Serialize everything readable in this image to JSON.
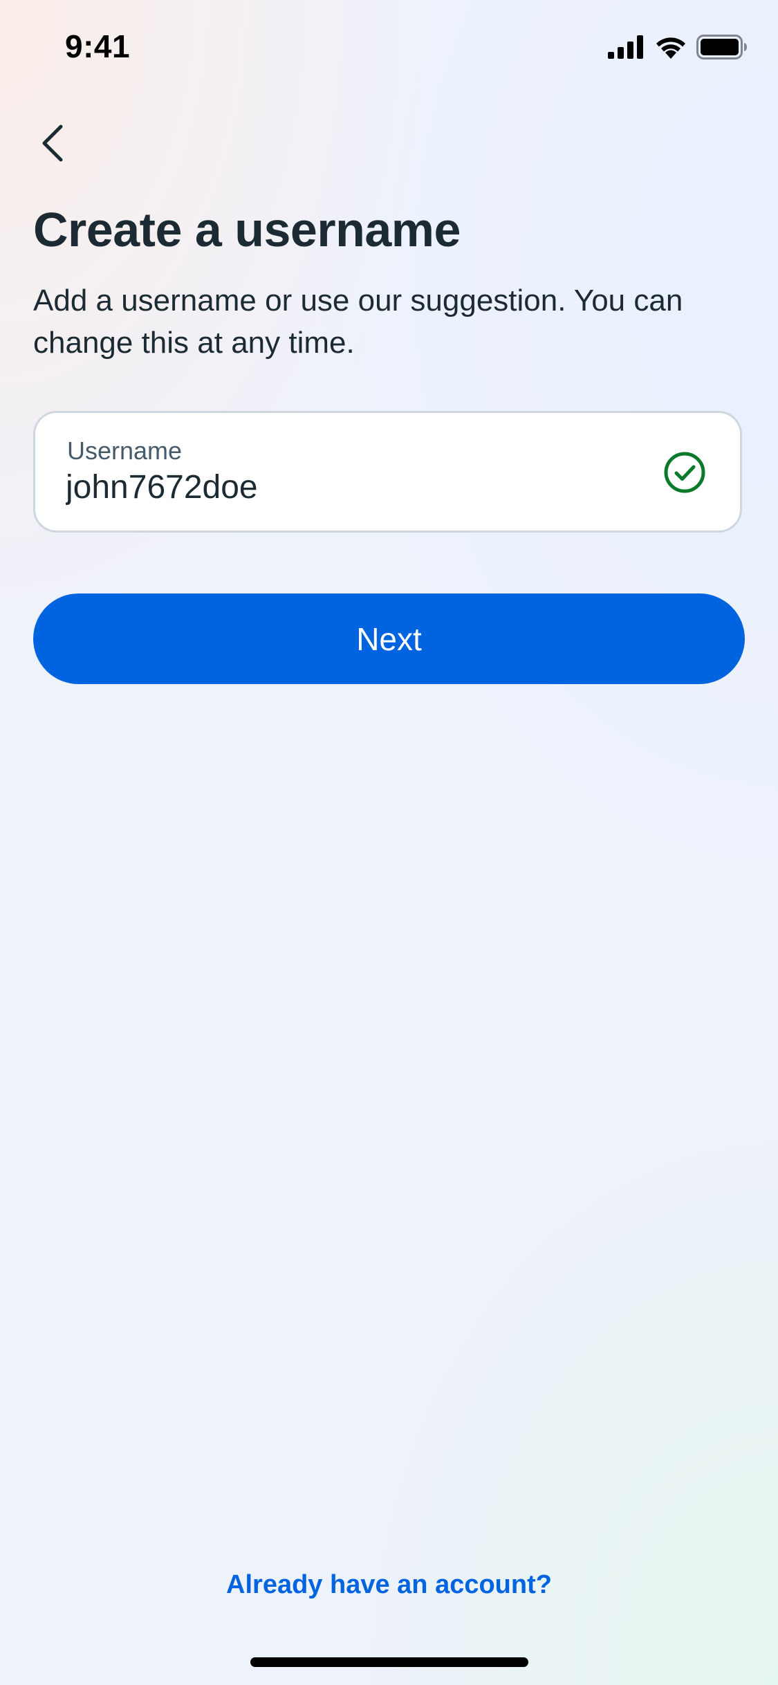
{
  "status_bar": {
    "time": "9:41",
    "signal_icon": "cellular-signal-icon",
    "wifi_icon": "wifi-icon",
    "battery_icon": "battery-full-icon"
  },
  "header": {
    "back_icon": "chevron-left-icon",
    "title": "Create a username",
    "subtitle": "Add a username or use our suggestion. You can change this at any time."
  },
  "username_field": {
    "label": "Username",
    "value": "john7672doe",
    "status_icon": "check-circle-icon",
    "status_color": "#0a7a2a"
  },
  "primary_button": {
    "label": "Next",
    "color": "#0064e0"
  },
  "footer": {
    "link_label": "Already have an account?"
  }
}
